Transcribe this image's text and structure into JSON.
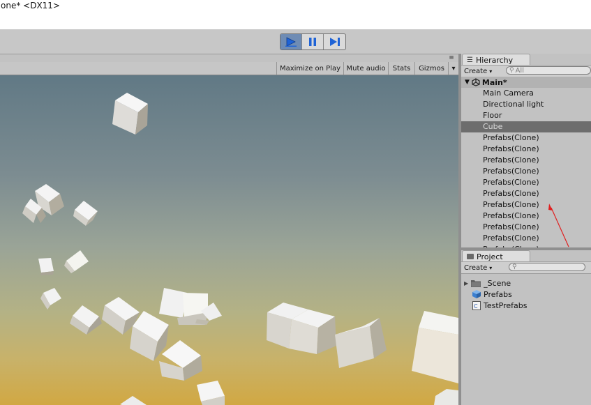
{
  "window": {
    "title": "one* <DX11>"
  },
  "toolbar": {
    "play_icon": "play-icon",
    "pause_icon": "pause-icon",
    "step_icon": "step-icon",
    "active_color": "#6f8cb4"
  },
  "game_view": {
    "options": [
      "Maximize on Play",
      "Mute audio",
      "Stats",
      "Gizmos"
    ],
    "gizmos_arrow": "▾",
    "tab_menu": "≡"
  },
  "hierarchy": {
    "tab_label": "Hierarchy",
    "create_label": "Create",
    "search_placeholder": "All",
    "scene_name": "Main*",
    "items": [
      {
        "label": "Main Camera",
        "selected": false
      },
      {
        "label": "Directional light",
        "selected": false
      },
      {
        "label": "Floor",
        "selected": false
      },
      {
        "label": "Cube",
        "selected": true
      },
      {
        "label": "Prefabs(Clone)",
        "selected": false
      },
      {
        "label": "Prefabs(Clone)",
        "selected": false
      },
      {
        "label": "Prefabs(Clone)",
        "selected": false
      },
      {
        "label": "Prefabs(Clone)",
        "selected": false
      },
      {
        "label": "Prefabs(Clone)",
        "selected": false
      },
      {
        "label": "Prefabs(Clone)",
        "selected": false
      },
      {
        "label": "Prefabs(Clone)",
        "selected": false
      },
      {
        "label": "Prefabs(Clone)",
        "selected": false
      },
      {
        "label": "Prefabs(Clone)",
        "selected": false
      },
      {
        "label": "Prefabs(Clone)",
        "selected": false
      },
      {
        "label": "Prefabs(Clone)",
        "selected": false
      }
    ]
  },
  "project": {
    "tab_label": "Project",
    "create_label": "Create",
    "items": [
      {
        "label": "_Scene",
        "icon": "folder-icon"
      },
      {
        "label": "Prefabs",
        "icon": "prefab-cube-icon"
      },
      {
        "label": "TestPrefabs",
        "icon": "csharp-script-icon"
      }
    ]
  },
  "annotation": {
    "color": "#e02020"
  }
}
